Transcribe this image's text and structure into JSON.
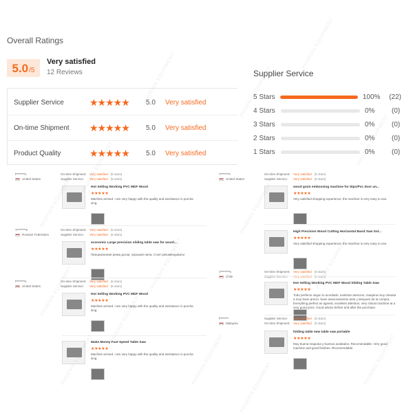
{
  "overall": {
    "title": "Overall Ratings",
    "score": "5.0",
    "score_max": "/5",
    "verdict": "Very satisfied",
    "reviews": "12 Reviews"
  },
  "ratings": [
    {
      "label": "Supplier Service",
      "stars": "★★★★★",
      "value": "5.0",
      "verdict": "Very satisfied"
    },
    {
      "label": "On-time Shipment",
      "stars": "★★★★★",
      "value": "5.0",
      "verdict": "Very satisfied"
    },
    {
      "label": "Product Quality",
      "stars": "★★★★★",
      "value": "5.0",
      "verdict": "Very satisfied"
    }
  ],
  "supplier_service": {
    "title": "Supplier Service",
    "rows": [
      {
        "label": "5 Stars",
        "percent": 100,
        "pct_text": "100%",
        "count": "(22)"
      },
      {
        "label": "4 Stars",
        "percent": 0,
        "pct_text": "0%",
        "count": "(0)"
      },
      {
        "label": "3 Stars",
        "percent": 0,
        "pct_text": "0%",
        "count": "(0)"
      },
      {
        "label": "2 Stars",
        "percent": 0,
        "pct_text": "0%",
        "count": "(0)"
      },
      {
        "label": "1 Stars",
        "percent": 0,
        "pct_text": "0%",
        "count": "(0)"
      }
    ]
  },
  "watermark": "PHOENIX EQUIPMENT",
  "reviews_left": [
    {
      "user": "f*********n",
      "country": "United States",
      "k1": "On-time Shipment:",
      "v1": "Very satisfied",
      "n1": "(5 stars)",
      "k2": "Supplier Service:",
      "v2": "Very satisfied",
      "n2": "(5 stars)",
      "product": "Hot Selling Working PVC MDF Wood",
      "stars": "★★★★★",
      "text": "Machine arrived. I am very happy with the quality and assistance in purcha sing."
    },
    {
      "user": "Y*********e",
      "country": "Russian Federation",
      "k1": "On-time Shipment:",
      "v1": "Very satisfied",
      "n1": "(5 stars)",
      "k2": "Supplier Service:",
      "v2": "Very satisfied",
      "n2": "(5 stars)",
      "product": "economic Large precision sliding table saw for wood...",
      "stars": "★★★★★",
      "text": "Прецизионная резка доски, хорошая пила, стоит рекомендовать!"
    },
    {
      "user": "f*********n",
      "country": "United States",
      "k1": "On-time Shipment:",
      "v1": "Very satisfied",
      "n1": "(5 stars)",
      "k2": "Supplier Service:",
      "v2": "Very satisfied",
      "n2": "(5 stars)",
      "product": "Hot Selling Working PVC MDF Wood",
      "stars": "★★★★★",
      "text": "Machine arrived. I am very happy with the quality and assistance in purcha sing."
    },
    {
      "user": "",
      "country": "",
      "k1": "",
      "v1": "",
      "n1": "",
      "k2": "",
      "v2": "",
      "n2": "",
      "product": "Make Money Fast Speed Table Saw",
      "stars": "★★★★★",
      "text": "Machine arrived. I am very happy with the quality and assistance in purcha sing."
    }
  ],
  "reviews_right": [
    {
      "user": "T*********r",
      "country": "United States",
      "k1": "On-time Shipment:",
      "v1": "Very satisfied",
      "n1": "(5 stars)",
      "k2": "Supplier Service:",
      "v2": "Very satisfied",
      "n2": "(5 stars)",
      "product": "wood grain embossing machine for Wpc/Pvc door an...",
      "stars": "★★★★★",
      "text": "Very satisfied shopping experience, the machine is very easy to use."
    },
    {
      "user": "",
      "country": "",
      "k1": "",
      "v1": "",
      "n1": "",
      "k2": "",
      "v2": "",
      "n2": "",
      "product": "High Precision Wood Cutting Horizontal Band Saw Sol...",
      "stars": "★★★★★",
      "text": "Very satisfied shopping experience, the machine is very easy to use."
    },
    {
      "user": "V*********s",
      "country": "Chile",
      "k1": "On-time Shipment:",
      "v1": "Very satisfied",
      "n1": "(5 stars)",
      "k2": "Supplier Service:",
      "v2": "Very satisfied",
      "n2": "(5 stars)",
      "product": "Hot Selling Working PVC MDF Wood Sliding Table Saw",
      "stars": "★★★★★",
      "text": "Todo perfecto segun lo acordado, exelente atencion, maquina muy robusta a muy buen precio. buen asesoramiento ante y despues de la compra. Everything perfect as agreed, excellent attention, very robust machine at a very good price. Good advice before and after the purchase."
    },
    {
      "user": "f*********",
      "country": "Malaysia",
      "k1": "Supplier Service:",
      "v1": "Very satisfied",
      "n1": "(5 stars)",
      "k2": "On-time Shipment:",
      "v2": "Very satisfied",
      "n2": "(5 stars)",
      "product": "folding table new table saw portable",
      "stars": "★★★★★",
      "text": "Muy buena maquina y buenos acabados. Recomendable. Very good machine and good finishes. Recomendable."
    }
  ]
}
